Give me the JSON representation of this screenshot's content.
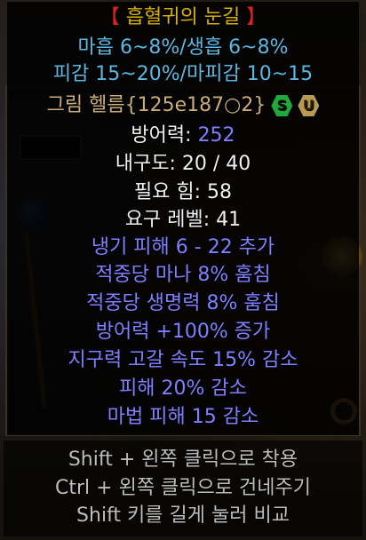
{
  "item": {
    "name": "흡혈귀의 눈길",
    "bracket_open": "【",
    "bracket_close": "】",
    "attr_line_1": "마흡 6~8%/생흡 6~8%",
    "attr_line_2": "피감 15~20%/마피감 10~15",
    "base_name": "그림 헬름{125e187○2}",
    "badges": {
      "set_icon": "S",
      "unique_icon": "U",
      "set_color": "#1fa83c",
      "unique_color": "#b89a52"
    },
    "defense_label": "방어력:",
    "defense_value": "252",
    "durability": "내구도: 20 / 40",
    "required_strength": "필요 힘: 58",
    "required_level": "요구 레벨: 41",
    "mods": [
      "냉기 피해 6 - 22 추가",
      "적중당 마나 8% 훔침",
      "적중당 생명력 8% 훔침",
      "방어력 +100% 증가",
      "지구력 고갈 속도 15% 감소",
      "피해 20% 감소",
      "마법 피해 15 감소"
    ]
  },
  "hints": [
    "Shift + 왼쪽 클릭으로 착용",
    "Ctrl + 왼쪽 클릭으로 건네주기",
    "Shift 키를 길게 눌러 비교"
  ],
  "colors": {
    "title": "#d6b000",
    "bracket": "#e02020",
    "attribute": "#5cb8e0",
    "base": "#c9ac7a",
    "stat": "#f0f0f0",
    "magic": "#7f7fff",
    "hint": "#bcbcbc"
  }
}
